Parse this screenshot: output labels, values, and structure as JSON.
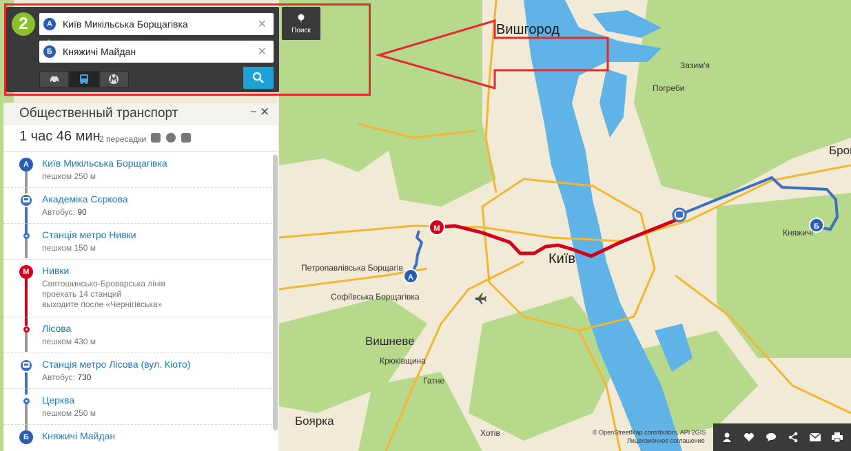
{
  "search": {
    "from_marker": "А",
    "from_value": "Київ Микільська Борщагівка",
    "to_marker": "Б",
    "to_value": "Княжичі Майдан",
    "poi_label": "Поиск",
    "modes": [
      "car-icon",
      "bus-icon",
      "metro-icon"
    ],
    "active_mode": "bus-icon"
  },
  "results": {
    "title": "Общественный транспорт",
    "duration": "1 час 46 мин",
    "transfers": "2 пересадки",
    "summary_icons": [
      "bus-icon",
      "metro-icon",
      "bus-icon"
    ],
    "steps": [
      {
        "marker": "А",
        "name": "Київ Микільська Борщагівка",
        "sub": "пешком 250 м",
        "kind": "start"
      },
      {
        "name": "Академіка Сєркова",
        "sub_label": "Автобус:",
        "sub_value": "90",
        "kind": "bus"
      },
      {
        "name": "Станція метро Нивки",
        "sub": "пешком 150 м",
        "kind": "dot-blue"
      },
      {
        "name": "Нивки",
        "sub_lines": [
          "Святошинсько-Броварська лінія",
          "проехать 14 станций",
          "выходите после «Чернігівська»"
        ],
        "kind": "metro"
      },
      {
        "name": "Лісова",
        "sub": "пешком 430 м",
        "kind": "dot-red"
      },
      {
        "name": "Станція метро Лісова (вул. Кіото)",
        "sub_label": "Автобус:",
        "sub_value": "730",
        "kind": "bus"
      },
      {
        "name": "Церква",
        "sub": "пешком 250 м",
        "kind": "dot-blue"
      },
      {
        "marker": "Б",
        "name": "Княжичі Майдан",
        "kind": "end"
      }
    ]
  },
  "map": {
    "labels": {
      "vyshhorod": "Вишгород",
      "kyiv": "Київ",
      "vyshneve": "Вишневе",
      "boiarka": "Боярка",
      "brovary": "Бровар",
      "petropavlivska": "Петропавлівська Борщагів",
      "sofiivska": "Софіївська Борщагівка",
      "kriukivshchyna": "Крюківщина",
      "hatne": "Гатне",
      "khotiv": "Хотів",
      "zazymia": "Зазим'я",
      "pohreby": "Погреби",
      "kniazhychi": "Княжичі"
    },
    "route_markers": {
      "start": "А",
      "end": "Б",
      "metro": "М"
    },
    "colors": {
      "metro_line": "#d0021b",
      "bus_line": "#3f6fbf",
      "water": "#5fb3e6",
      "forest": "#b7d98b",
      "road": "#f2b632",
      "land": "#f1ead6"
    }
  },
  "attribution": {
    "line1": "© OpenStreetMap contributors, API 2GIS",
    "line2": "Лицензионное соглашение"
  },
  "toolbar": [
    "person-icon",
    "heart-icon",
    "chat-icon",
    "share-icon",
    "mail-icon",
    "print-icon"
  ]
}
